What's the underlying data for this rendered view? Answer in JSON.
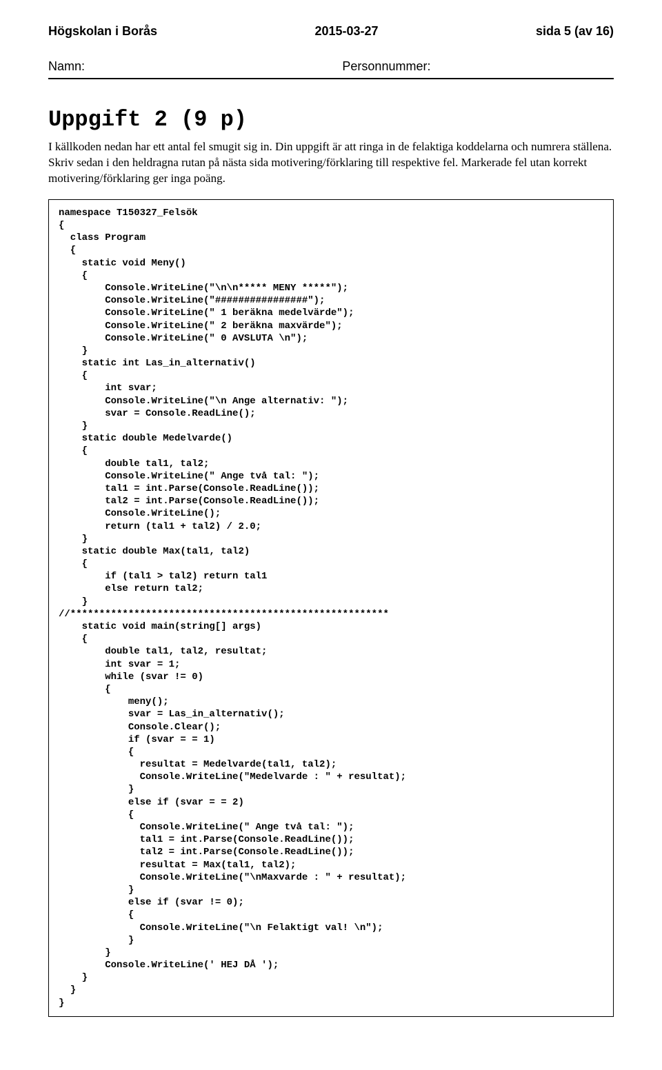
{
  "header": {
    "school": "Högskolan i Borås",
    "date": "2015-03-27",
    "page_info": "sida 5 (av 16)",
    "name_label": "Namn:",
    "pn_label": "Personnummer:"
  },
  "content": {
    "title": "Uppgift 2  (9 p)",
    "para": "I källkoden nedan har ett antal fel smugit sig in. Din uppgift är att ringa in de felaktiga koddelarna och numrera ställena. Skriv sedan i den heldragna rutan på nästa sida motivering/förklaring till respektive fel. Markerade fel utan korrekt motivering/förklaring ger inga poäng."
  },
  "code": "namespace T150327_Felsök\n{\n  class Program\n  {\n    static void Meny()\n    {\n        Console.WriteLine(\"\\n\\n***** MENY *****\");\n        Console.WriteLine(\"################\");\n        Console.WriteLine(\" 1 beräkna medelvärde\");\n        Console.WriteLine(\" 2 beräkna maxvärde\");\n        Console.WriteLine(\" 0 AVSLUTA \\n\");\n    }\n    static int Las_in_alternativ()\n    {\n        int svar;\n        Console.WriteLine(\"\\n Ange alternativ: \");\n        svar = Console.ReadLine();\n    }\n    static double Medelvarde()\n    {\n        double tal1, tal2;\n        Console.WriteLine(\" Ange två tal: \");\n        tal1 = int.Parse(Console.ReadLine());\n        tal2 = int.Parse(Console.ReadLine());\n        Console.WriteLine();\n        return (tal1 + tal2) / 2.0;\n    }\n    static double Max(tal1, tal2)\n    {\n        if (tal1 > tal2) return tal1\n        else return tal2;\n    }\n//*******************************************************\n    static void main(string[] args)\n    {\n        double tal1, tal2, resultat;\n        int svar = 1;\n        while (svar != 0)\n        {\n            meny();\n            svar = Las_in_alternativ();\n            Console.Clear();\n            if (svar = = 1)\n            {\n              resultat = Medelvarde(tal1, tal2);\n              Console.WriteLine(\"Medelvarde : \" + resultat);\n            }\n            else if (svar = = 2)\n            {\n              Console.WriteLine(\" Ange två tal: \");\n              tal1 = int.Parse(Console.ReadLine());\n              tal2 = int.Parse(Console.ReadLine());\n              resultat = Max(tal1, tal2);\n              Console.WriteLine(\"\\nMaxvarde : \" + resultat);\n            }\n            else if (svar != 0);\n            {\n              Console.WriteLine(\"\\n Felaktigt val! \\n\");\n            }\n        }\n        Console.WriteLine(' HEJ DÅ ');\n    }\n  }\n}"
}
